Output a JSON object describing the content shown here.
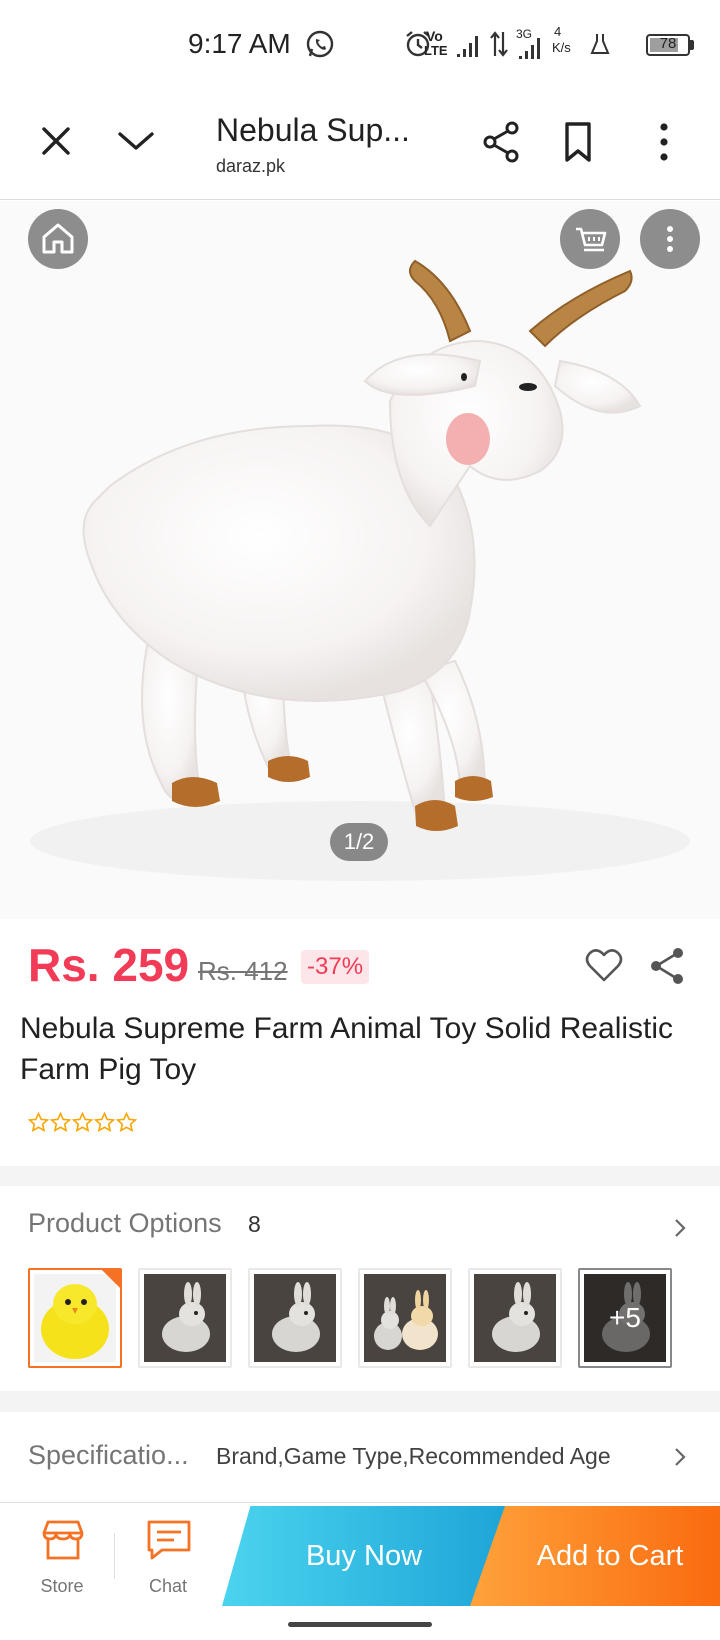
{
  "status_bar": {
    "time": "9:17 AM",
    "network_label_top": "Vo",
    "network_label_bottom": "LTE",
    "network_gen": "3G",
    "speed_value": "4",
    "speed_unit": "K/s",
    "battery": "78",
    "battery_level": 0.78
  },
  "browser": {
    "title": "Nebula Sup...",
    "url": "daraz.pk",
    "close_icon": "close-icon",
    "collapse_icon": "chevron-down-icon",
    "share_icon": "share-icon",
    "bookmark_icon": "bookmark-icon",
    "menu_icon": "more-vertical-icon"
  },
  "gallery": {
    "counter": "1/2",
    "home_icon": "home-icon",
    "cart_icon": "cart-icon",
    "more_icon": "more-vertical-icon"
  },
  "product": {
    "price": "Rs. 259",
    "original_price": "Rs. 412",
    "discount": "-37%",
    "title": "Nebula Supreme Farm Animal Toy Solid Realistic Farm Pig Toy",
    "rating_stars": 0,
    "wishlist_icon": "heart-icon",
    "share_icon": "share-icon"
  },
  "options": {
    "label": "Product Options",
    "count": "8",
    "more_label": "+5",
    "thumbnails": [
      "yellow-chick",
      "grey-rabbit",
      "grey-rabbit",
      "rabbit-pair",
      "grey-rabbit",
      "dark-rabbit"
    ]
  },
  "specifications": {
    "label": "Specificatio...",
    "values": "Brand,Game Type,Recommended Age"
  },
  "bottom_bar": {
    "store_label": "Store",
    "chat_label": "Chat",
    "buy_now_label": "Buy Now",
    "add_to_cart_label": "Add to Cart"
  },
  "colors": {
    "price": "#f23c57",
    "accent_orange": "#f57224",
    "buy_now": "#1ea5d8",
    "add_to_cart": "#fa6b10"
  }
}
